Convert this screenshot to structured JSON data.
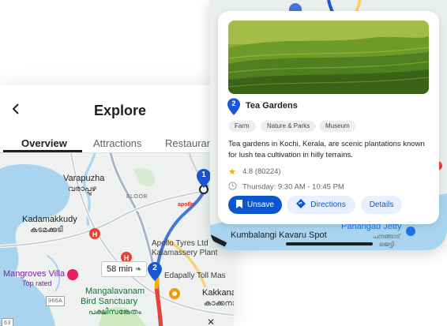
{
  "explore": {
    "title": "Explore",
    "tabs": [
      "Overview",
      "Attractions",
      "Restaurants"
    ],
    "map": {
      "labels": {
        "varapuzha": "Varapuzha",
        "varapuzha_ml": "വരാപ്പുഴ",
        "eloor": "ELOOR",
        "kadamakkudy": "Kadamakkudy",
        "kadamakkudy_ml": "കടമക്കുടി",
        "apollo": "Apollo Tyres Ltd",
        "apollo2": "Kalamassery Plant",
        "apollo_sign": "apollo",
        "mangroves": "Mangroves Villa",
        "top_rated": "Top rated",
        "edapally": "Edapally Toll Mas",
        "mangalavanam": "Mangalavanam",
        "bird_sanctuary": "Bird Sanctuary",
        "bird_sanctuary_ml": "പക്ഷിസങ്കേതം",
        "kakkana": "Kakkana",
        "kakkana_ml": "കാക്കനാ",
        "road_966a": "966A",
        "road_63": "63"
      },
      "pins": [
        "1",
        "2"
      ],
      "eta": "58 min",
      "close": "✕"
    }
  },
  "card": {
    "pin_number": "2",
    "title": "Tea Gardens",
    "chips": [
      "Farm",
      "Nature & Parks",
      "Museum"
    ],
    "description": "Tea gardens in Kochi, Kerala, are scenic plantations known for lush tea cultivation in hilly terrains.",
    "rating": "4.8 (80224)",
    "hours": "Thursday: 9:30 AM - 10:45 PM",
    "buttons": {
      "unsave": "Unsave",
      "directions": "Directions",
      "details": "Details"
    }
  },
  "card_map": {
    "kumbalangi": "Kumbalangi Kavaru Spot",
    "panangad": "Panangad Jetty",
    "panangad_ml": "പനങ്ങാട്",
    "panangad_ml2": "ജെട്ടി"
  },
  "colors": {
    "primary": "#0b57d0",
    "route": "#ea4335",
    "pin": "#1a56d6"
  }
}
